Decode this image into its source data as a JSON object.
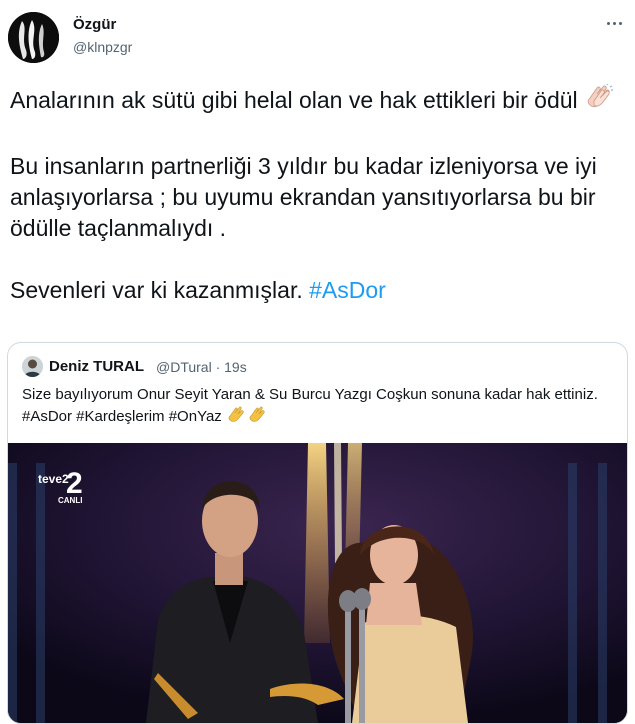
{
  "author": {
    "name": "Özgür",
    "handle": "@klnpzgr"
  },
  "tweet": {
    "paragraphs": [
      "Analarının ak sütü gibi helal olan ve hak ettikleri bir ödül",
      "Bu insanların partnerliği 3 yıldır bu kadar izleniyorsa ve iyi anlaşıyorlarsa ; bu uyumu ekrandan yansıtıyorlarsa bu bir ödülle taçlanmalıydı .",
      "Sevenleri var ki kazanmışlar."
    ],
    "hashtag": "#AsDor"
  },
  "quoted": {
    "name": "Deniz TURAL",
    "handle_time": "@DTural · 19s",
    "text": "Size bayılıyorum Onur Seyit Yaran & Su Burcu Yazgı Coşkun sonuna kadar hak ettiniz.",
    "hashtags": "#AsDor #Kardeşlerim #OnYaz",
    "media": {
      "channel_logo": "teve2",
      "channel_number": "2",
      "live_label": "CANLI"
    }
  },
  "icons": {
    "more": "more-horizontal-icon",
    "clap": "clapping-hands-icon"
  },
  "colors": {
    "link": "#1d9bf0",
    "secondary_text": "#536471",
    "border": "#cfd9de"
  }
}
